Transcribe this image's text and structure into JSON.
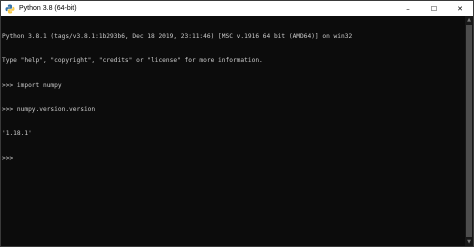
{
  "window": {
    "title": "Python 3.8 (64-bit)",
    "app_icon": "python-icon",
    "controls": {
      "minimize": "–",
      "maximize": "☐",
      "close": "✕"
    }
  },
  "console": {
    "lines": [
      "Python 3.8.1 (tags/v3.8.1:1b293b6, Dec 18 2019, 23:11:46) [MSC v.1916 64 bit (AMD64)] on win32",
      "Type \"help\", \"copyright\", \"credits\" or \"license\" for more information.",
      ">>> import numpy",
      ">>> numpy.version.version",
      "'1.18.1'",
      ">>>"
    ]
  },
  "colors": {
    "background": "#0c0c0c",
    "text": "#cccccc",
    "titlebar": "#ffffff"
  }
}
